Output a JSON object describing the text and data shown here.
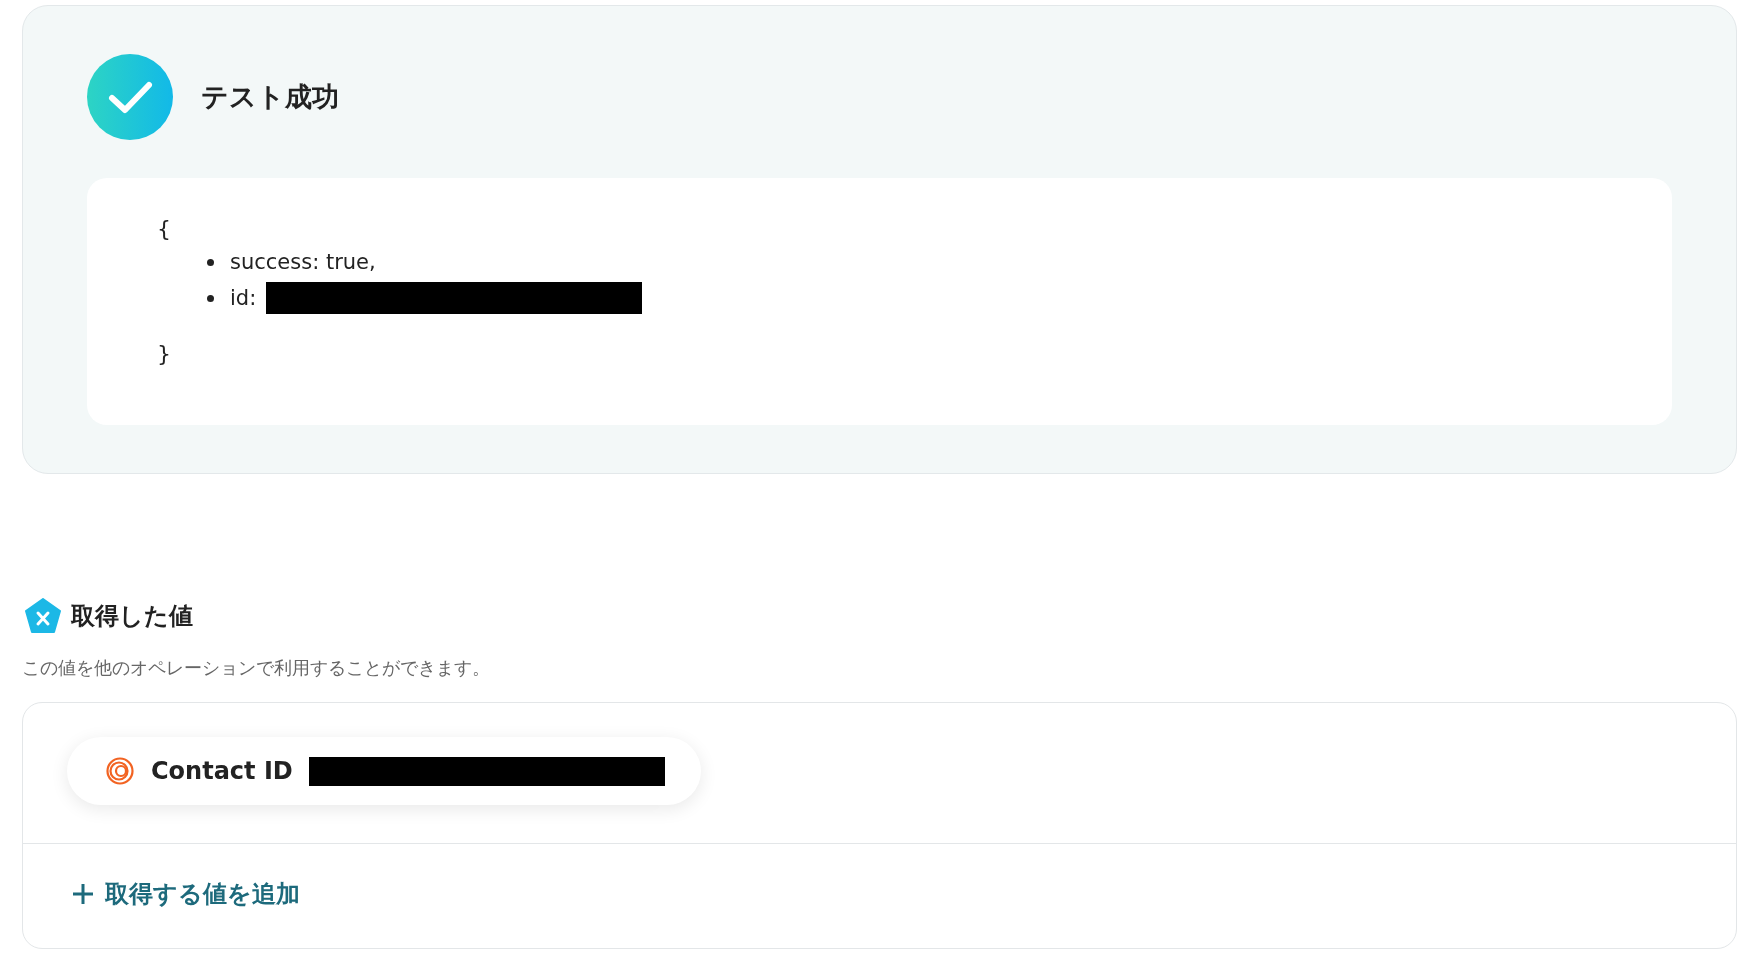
{
  "test_result": {
    "title": "テスト成功",
    "open_brace": "{",
    "items": [
      {
        "text": "success: true,",
        "redacted": false
      },
      {
        "text": "id:",
        "redacted": true
      }
    ],
    "close_brace": "}"
  },
  "values_section": {
    "title": "取得した値",
    "description": "この値を他のオペレーションで利用することができます。",
    "values": [
      {
        "label": "Contact ID",
        "redacted": true
      }
    ],
    "add_link": "取得する値を追加"
  }
}
